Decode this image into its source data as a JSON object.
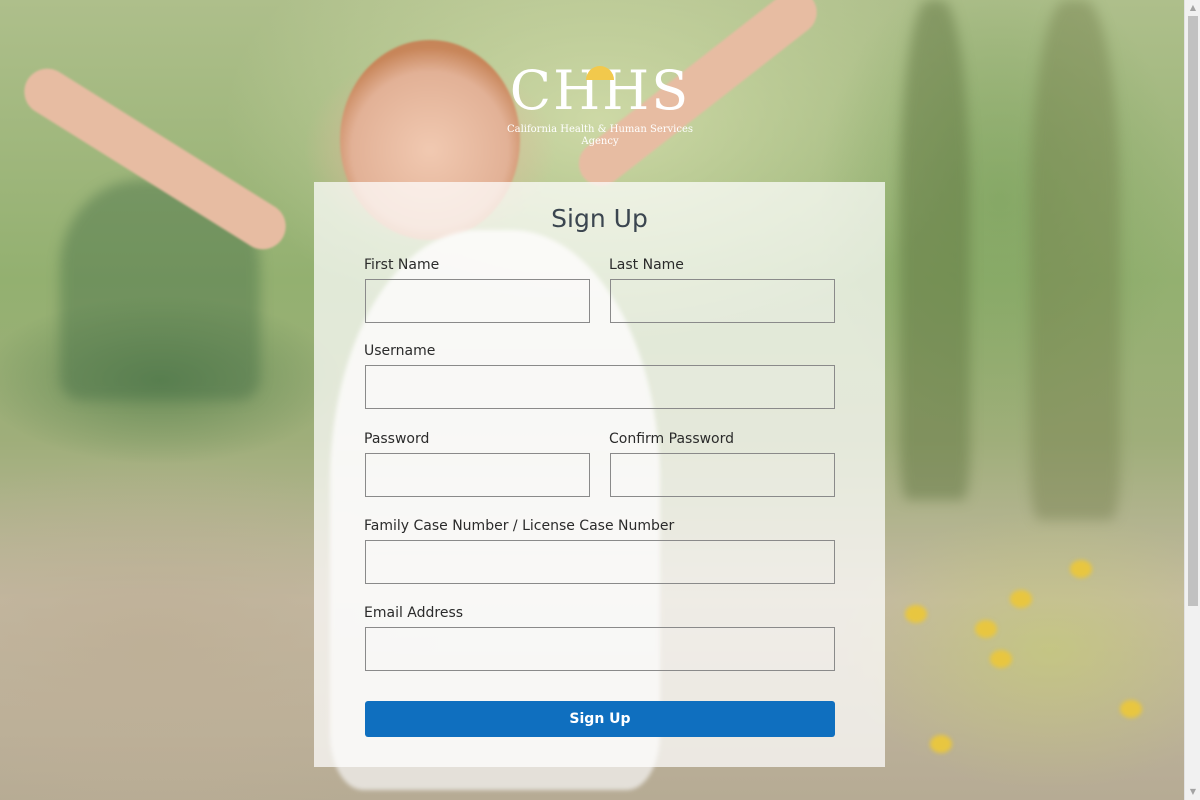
{
  "logo": {
    "wordmark": "CHHS",
    "tagline": "California Health & Human Services Agency"
  },
  "form": {
    "title": "Sign Up",
    "first_name_label": "First Name",
    "last_name_label": "Last Name",
    "username_label": "Username",
    "password_label": "Password",
    "confirm_password_label": "Confirm Password",
    "case_number_label": "Family Case Number / License Case Number",
    "email_label": "Email Address",
    "submit_label": "Sign Up"
  },
  "colors": {
    "button": "#0f6fbf",
    "panel": "#ffffff"
  }
}
